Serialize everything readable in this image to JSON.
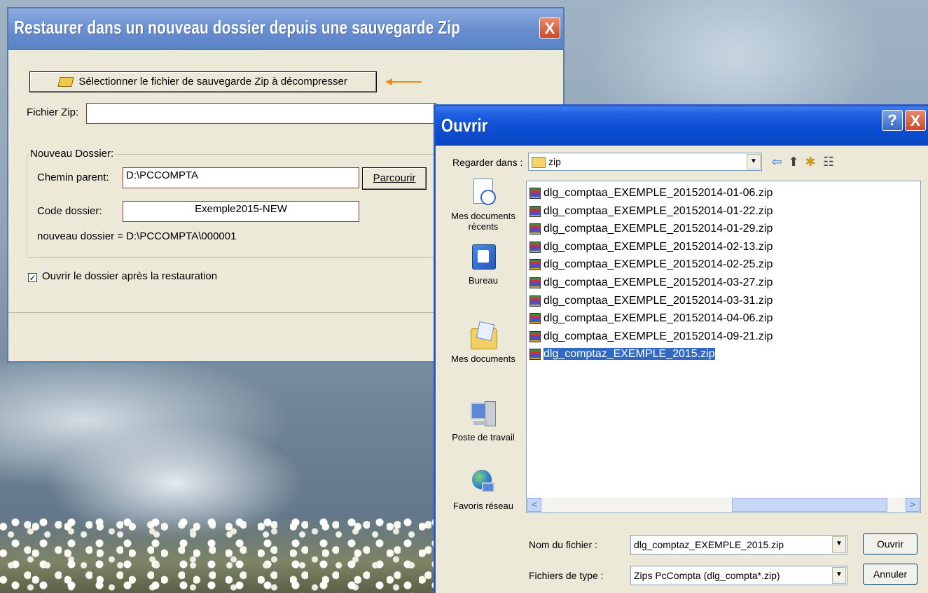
{
  "desktop": {},
  "restore_dialog": {
    "title": "Restaurer dans un nouveau dossier depuis une sauvegarde Zip",
    "close_glyph": "X",
    "select_button_label": "Sélectionner le fichier de sauvegarde Zip à décompresser",
    "zip_label": "Fichier Zip:",
    "zip_value": "",
    "group_title": "Nouveau Dossier:",
    "parent_label": "Chemin parent:",
    "parent_value": "D:\\PCCOMPTA",
    "browse_label": "Parcourir",
    "code_label": "Code dossier:",
    "code_value": "Exemple2015-NEW",
    "new_folder_text": "nouveau dossier = D:\\PCCOMPTA\\000001",
    "open_after_label": "Ouvrir le dossier après la restauration",
    "open_after_checked": true,
    "arrow_color": "#f08a1c"
  },
  "open_dialog": {
    "title": "Ouvrir",
    "help_glyph": "?",
    "close_glyph": "X",
    "look_in_label": "Regarder dans :",
    "look_in_value": "zip",
    "places": [
      {
        "label": "Mes documents récents",
        "icon": "recent-documents-icon"
      },
      {
        "label": "Bureau",
        "icon": "desktop-icon"
      },
      {
        "label": "Mes documents",
        "icon": "my-documents-icon"
      },
      {
        "label": "Poste de travail",
        "icon": "my-computer-icon"
      },
      {
        "label": "Favoris réseau",
        "icon": "network-places-icon"
      }
    ],
    "files": [
      "dlg_comptaa_EXEMPLE_20152014-01-06.zip",
      "dlg_comptaa_EXEMPLE_20152014-01-22.zip",
      "dlg_comptaa_EXEMPLE_20152014-01-29.zip",
      "dlg_comptaa_EXEMPLE_20152014-02-13.zip",
      "dlg_comptaa_EXEMPLE_20152014-02-25.zip",
      "dlg_comptaa_EXEMPLE_20152014-03-27.zip",
      "dlg_comptaa_EXEMPLE_20152014-03-31.zip",
      "dlg_comptaa_EXEMPLE_20152014-04-06.zip",
      "dlg_comptaa_EXEMPLE_20152014-09-21.zip",
      "dlg_comptaz_EXEMPLE_2015.zip"
    ],
    "selected_file": "dlg_comptaz_EXEMPLE_2015.zip",
    "filename_label": "Nom du fichier :",
    "filename_value": "dlg_comptaz_EXEMPLE_2015.zip",
    "filetype_label": "Fichiers de type :",
    "filetype_value": "Zips PcCompta (dlg_compta*.zip)",
    "open_button": "Ouvrir",
    "cancel_button": "Annuler",
    "scroll_left": "<",
    "scroll_right": ">",
    "dropdown_glyph": "▼"
  }
}
